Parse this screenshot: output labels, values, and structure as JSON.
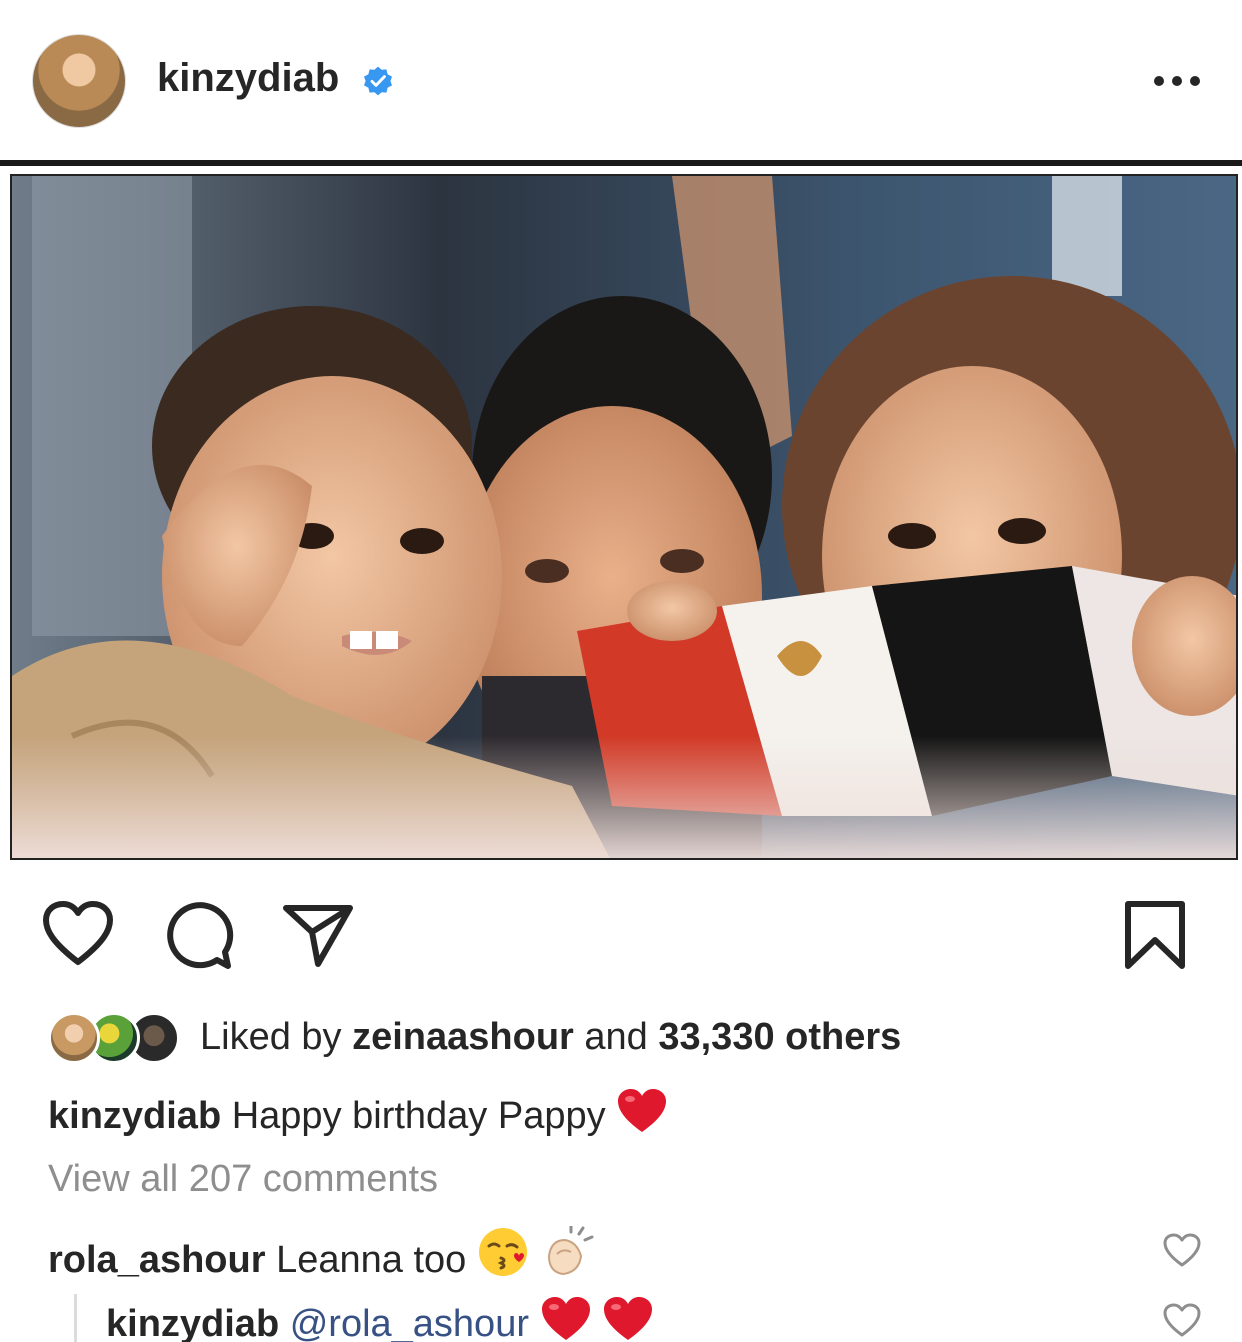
{
  "post": {
    "username": "kinzydiab",
    "verified": true,
    "more_label": "•••"
  },
  "likes": {
    "prefix": "Liked by ",
    "liker": "zeinaashour",
    "middle": " and ",
    "others": "33,330 others"
  },
  "caption": {
    "username": "kinzydiab",
    "text": "Happy birthday Pappy",
    "emoji": "heart"
  },
  "view_all_comments": "View all 207 comments",
  "comments": [
    {
      "username": "rola_ashour",
      "text": "Leanna too",
      "emojis": [
        "kissing-face",
        "clapping-hands"
      ]
    },
    {
      "username": "kinzydiab",
      "mention": "@rola_ashour",
      "emojis": [
        "heart",
        "heart"
      ]
    }
  ],
  "colors": {
    "text": "#262626",
    "muted": "#8e8e8e",
    "verified_blue": "#3897f0",
    "mention": "#385185",
    "heart_red": "#e0182d"
  }
}
